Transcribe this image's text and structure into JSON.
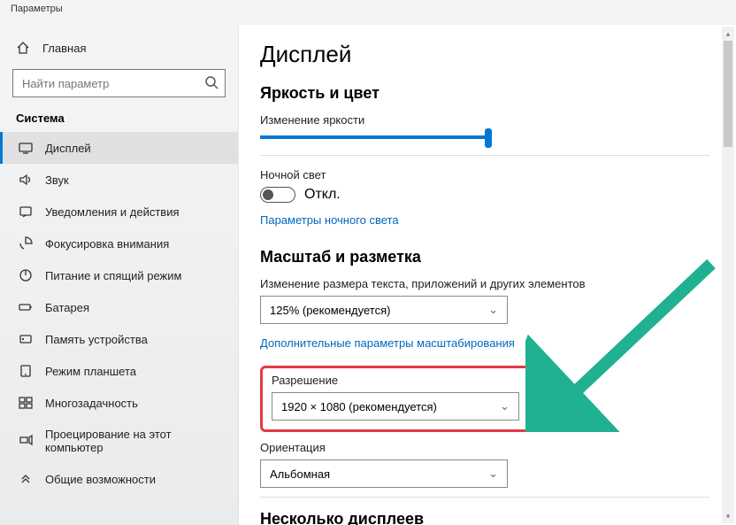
{
  "window": {
    "title": "Параметры"
  },
  "sidebar": {
    "home": "Главная",
    "search_placeholder": "Найти параметр",
    "section": "Система",
    "items": [
      {
        "label": "Дисплей"
      },
      {
        "label": "Звук"
      },
      {
        "label": "Уведомления и действия"
      },
      {
        "label": "Фокусировка внимания"
      },
      {
        "label": "Питание и спящий режим"
      },
      {
        "label": "Батарея"
      },
      {
        "label": "Память устройства"
      },
      {
        "label": "Режим планшета"
      },
      {
        "label": "Многозадачность"
      },
      {
        "label": "Проецирование на этот компьютер"
      },
      {
        "label": "Общие возможности"
      }
    ]
  },
  "main": {
    "title": "Дисплей",
    "brightness_section": "Яркость и цвет",
    "brightness_label": "Изменение яркости",
    "night_light_label": "Ночной свет",
    "night_light_state": "Откл.",
    "night_light_link": "Параметры ночного света",
    "scale_section": "Масштаб и разметка",
    "scale_label": "Изменение размера текста, приложений и других элементов",
    "scale_value": "125% (рекомендуется)",
    "scale_link": "Дополнительные параметры масштабирования",
    "resolution_label": "Разрешение",
    "resolution_value": "1920 × 1080 (рекомендуется)",
    "orientation_label": "Ориентация",
    "orientation_value": "Альбомная",
    "multi_section": "Несколько дисплеев"
  },
  "colors": {
    "accent": "#0078d4",
    "link": "#0067c0",
    "highlight": "#e53946",
    "arrow": "#1fb191"
  }
}
